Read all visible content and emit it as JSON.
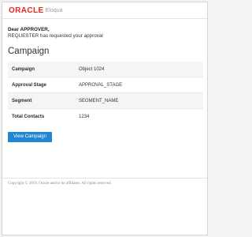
{
  "header": {
    "brand": "ORACLE",
    "product": "Eloqua"
  },
  "message": {
    "greeting": "Dear APPROVER,",
    "body": "REQUESTER has requested your approval"
  },
  "section": {
    "title": "Campaign"
  },
  "details": [
    {
      "label": "Campaign",
      "value": "Object 1024"
    },
    {
      "label": "Approval Stage",
      "value": "APPROVAL_STAGE"
    },
    {
      "label": "Segment",
      "value": "SEGMENT_NAME"
    },
    {
      "label": "Total Contacts",
      "value": "1234"
    }
  ],
  "actions": {
    "view_campaign": "View Campaign"
  },
  "footer": {
    "copyright": "Copyright © 2019, Oracle and/or its affiliates. All rights reserved."
  },
  "colors": {
    "brand_red": "#e8261f",
    "button_blue": "#1f86d2"
  }
}
